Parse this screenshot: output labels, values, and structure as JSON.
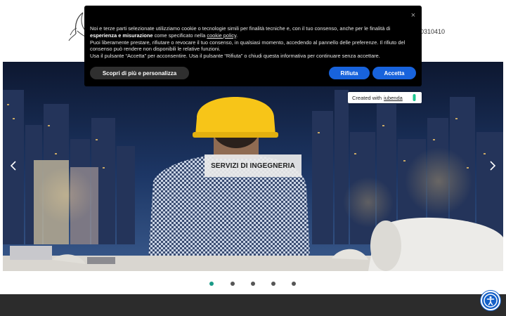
{
  "header": {
    "phone_fragment": "0310410"
  },
  "slider": {
    "caption": "SERVIZI DI INGEGNERIA",
    "slide_count": 5,
    "active_index": 0
  },
  "cookie": {
    "line1_a": "Noi e terze parti selezionate utilizziamo cookie o tecnologie simili per finalità tecniche e, con il tuo consenso, anche per le finalità di ",
    "line1_bold": "esperienza e misurazione",
    "line1_b": " come specificato nella ",
    "policy_link": "cookie policy",
    "line1_end": ".",
    "line2": "Puoi liberamente prestare, rifiutare o revocare il tuo consenso, in qualsiasi momento, accedendo al pannello delle preferenze. Il rifiuto del consenso può rendere non disponibili le relative funzioni.",
    "line3": "Usa il pulsante “Accetta” per acconsentire. Usa il pulsante “Rifiuta” o chiudi questa informativa per continuare senza accettare.",
    "more_button": "Scopri di più e personalizza",
    "reject_button": "Rifiuta",
    "accept_button": "Accetta",
    "close_glyph": "×"
  },
  "badge": {
    "prefix": "Created with",
    "link": "iubenda"
  },
  "colors": {
    "dot_active": "#1a9a87",
    "cookie_button": "#1863dc",
    "accessibility": "#1460c8",
    "footer": "#2c2c2c"
  },
  "icons": [
    "logo-icon",
    "close-icon",
    "chevron-left-icon",
    "chevron-right-icon",
    "accessibility-icon",
    "iubenda-leaf-icon"
  ]
}
